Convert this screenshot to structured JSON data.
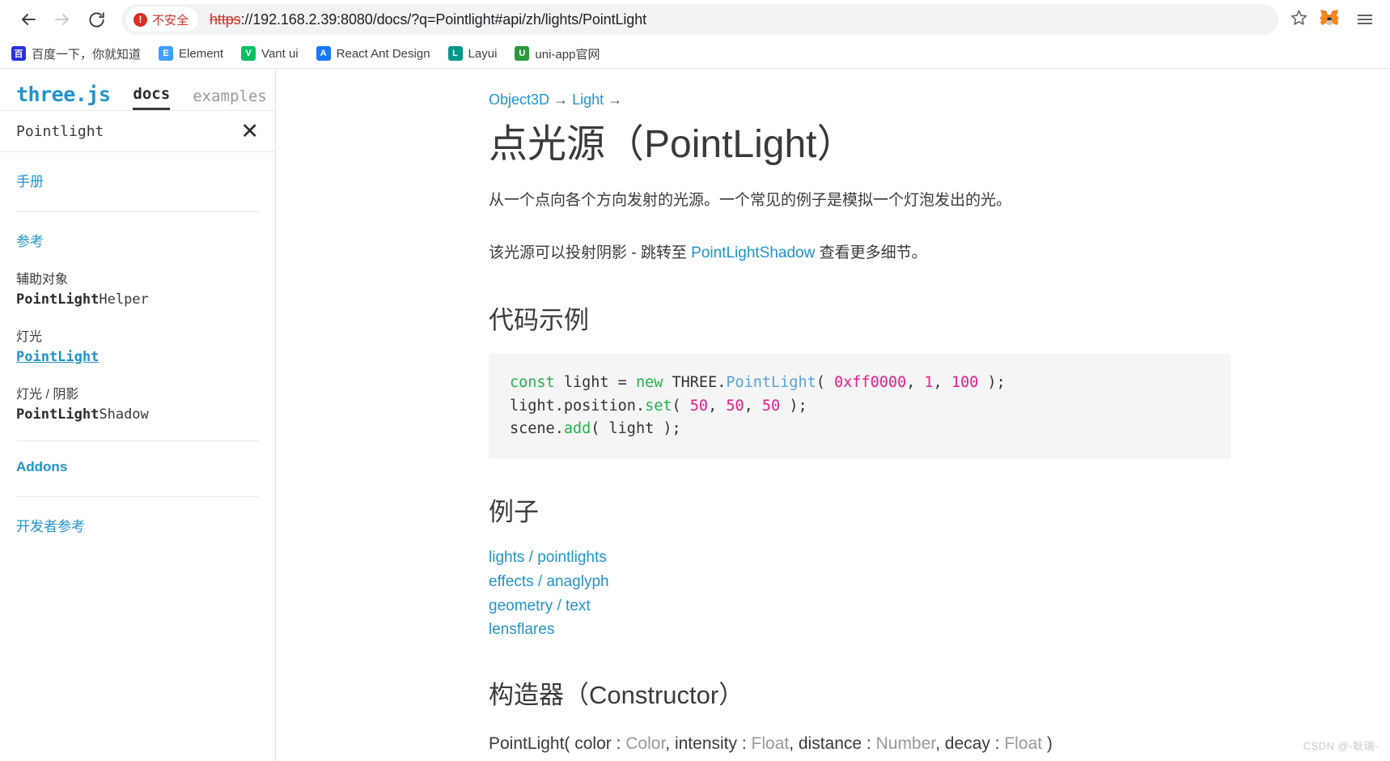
{
  "browser": {
    "back_icon": "back-arrow-icon",
    "forward_icon": "forward-arrow-icon",
    "reload_icon": "reload-icon",
    "security": {
      "label": "不安全",
      "icon": "danger-circle-icon",
      "color": "#d93025"
    },
    "url": {
      "scheme": "https",
      "rest": "://192.168.2.39:8080/docs/?q=Pointlight#api/zh/lights/PointLight",
      "full": "https://192.168.2.39:8080/docs/?q=Pointlight#api/zh/lights/PointLight"
    },
    "star_icon": "star-outline-icon",
    "extension_icon": "metamask-fox-icon",
    "menu_icon": "browser-menu-icon",
    "bookmarks": [
      {
        "label": "百度一下，你就知道",
        "icon": "baidu-icon",
        "color": "#2932e1",
        "glyph": "百"
      },
      {
        "label": "Element",
        "icon": "element-ui-icon",
        "color": "#409eff",
        "glyph": "E"
      },
      {
        "label": "Vant ui",
        "icon": "vant-ui-icon",
        "color": "#07c160",
        "glyph": "V"
      },
      {
        "label": "React Ant Design",
        "icon": "ant-design-icon",
        "color": "#1677ff",
        "glyph": "A"
      },
      {
        "label": "Layui",
        "icon": "layui-icon",
        "color": "#009688",
        "glyph": "L"
      },
      {
        "label": "uni-app官网",
        "icon": "uniapp-icon",
        "color": "#2b9939",
        "glyph": "U"
      }
    ]
  },
  "sidebar": {
    "brand": "three.js",
    "tabs": [
      {
        "label": "docs",
        "active": true
      },
      {
        "label": "examples",
        "active": false
      }
    ],
    "filter": {
      "value": "Pointlight",
      "clear_label": "✕"
    },
    "sections": [
      {
        "title": "手册",
        "groups": []
      },
      {
        "title": "参考",
        "groups": [
          {
            "label": "辅助对象",
            "bold": "PointLight",
            "rest": "Helper",
            "active": false
          },
          {
            "label": "灯光",
            "bold": "PointLight",
            "rest": "",
            "active": true
          },
          {
            "label": "灯光 / 阴影",
            "bold": "PointLight",
            "rest": "Shadow",
            "active": false
          }
        ]
      },
      {
        "title": "Addons",
        "groups": []
      },
      {
        "title": "开发者参考",
        "groups": []
      }
    ]
  },
  "main": {
    "breadcrumb": [
      {
        "label": "Object3D",
        "link": true
      },
      {
        "label": "→",
        "link": false
      },
      {
        "label": "Light",
        "link": true
      },
      {
        "label": "→",
        "link": false
      }
    ],
    "title": "点光源（PointLight）",
    "paragraph1": "从一个点向各个方向发射的光源。一个常见的例子是模拟一个灯泡发出的光。",
    "paragraph2_pre": "该光源可以投射阴影 - 跳转至 ",
    "paragraph2_link": "PointLightShadow",
    "paragraph2_post": " 查看更多细节。",
    "code_heading": "代码示例",
    "code_lines": [
      [
        {
          "t": "const",
          "c": "k-const"
        },
        {
          "t": " light ",
          "c": "k-plain"
        },
        {
          "t": "=",
          "c": "k-plain"
        },
        {
          "t": " ",
          "c": "k-plain"
        },
        {
          "t": "new",
          "c": "k-new"
        },
        {
          "t": " THREE.",
          "c": "k-plain"
        },
        {
          "t": "PointLight",
          "c": "k-cls"
        },
        {
          "t": "( ",
          "c": "k-plain"
        },
        {
          "t": "0xff0000",
          "c": "k-num"
        },
        {
          "t": ", ",
          "c": "k-plain"
        },
        {
          "t": "1",
          "c": "k-num"
        },
        {
          "t": ", ",
          "c": "k-plain"
        },
        {
          "t": "100",
          "c": "k-num"
        },
        {
          "t": " );",
          "c": "k-plain"
        }
      ],
      [
        {
          "t": "light.position.",
          "c": "k-plain"
        },
        {
          "t": "set",
          "c": "k-fn"
        },
        {
          "t": "( ",
          "c": "k-plain"
        },
        {
          "t": "50",
          "c": "k-num"
        },
        {
          "t": ", ",
          "c": "k-plain"
        },
        {
          "t": "50",
          "c": "k-num"
        },
        {
          "t": ", ",
          "c": "k-plain"
        },
        {
          "t": "50",
          "c": "k-num"
        },
        {
          "t": " );",
          "c": "k-plain"
        }
      ],
      [
        {
          "t": "scene.",
          "c": "k-plain"
        },
        {
          "t": "add",
          "c": "k-fn"
        },
        {
          "t": "( light );",
          "c": "k-plain"
        }
      ]
    ],
    "examples_heading": "例子",
    "examples": [
      "lights / pointlights",
      "effects / anaglyph",
      "geometry / text",
      "lensflares"
    ],
    "constructor_heading": "构造器（Constructor）",
    "signature": [
      {
        "t": "PointLight( color : ",
        "type": false
      },
      {
        "t": "Color",
        "type": true
      },
      {
        "t": ", intensity : ",
        "type": false
      },
      {
        "t": "Float",
        "type": true
      },
      {
        "t": ", distance : ",
        "type": false
      },
      {
        "t": "Number",
        "type": true
      },
      {
        "t": ", decay : ",
        "type": false
      },
      {
        "t": "Float",
        "type": true
      },
      {
        "t": " )",
        "type": false
      }
    ]
  },
  "watermark": "CSDN @-耿瑞-"
}
